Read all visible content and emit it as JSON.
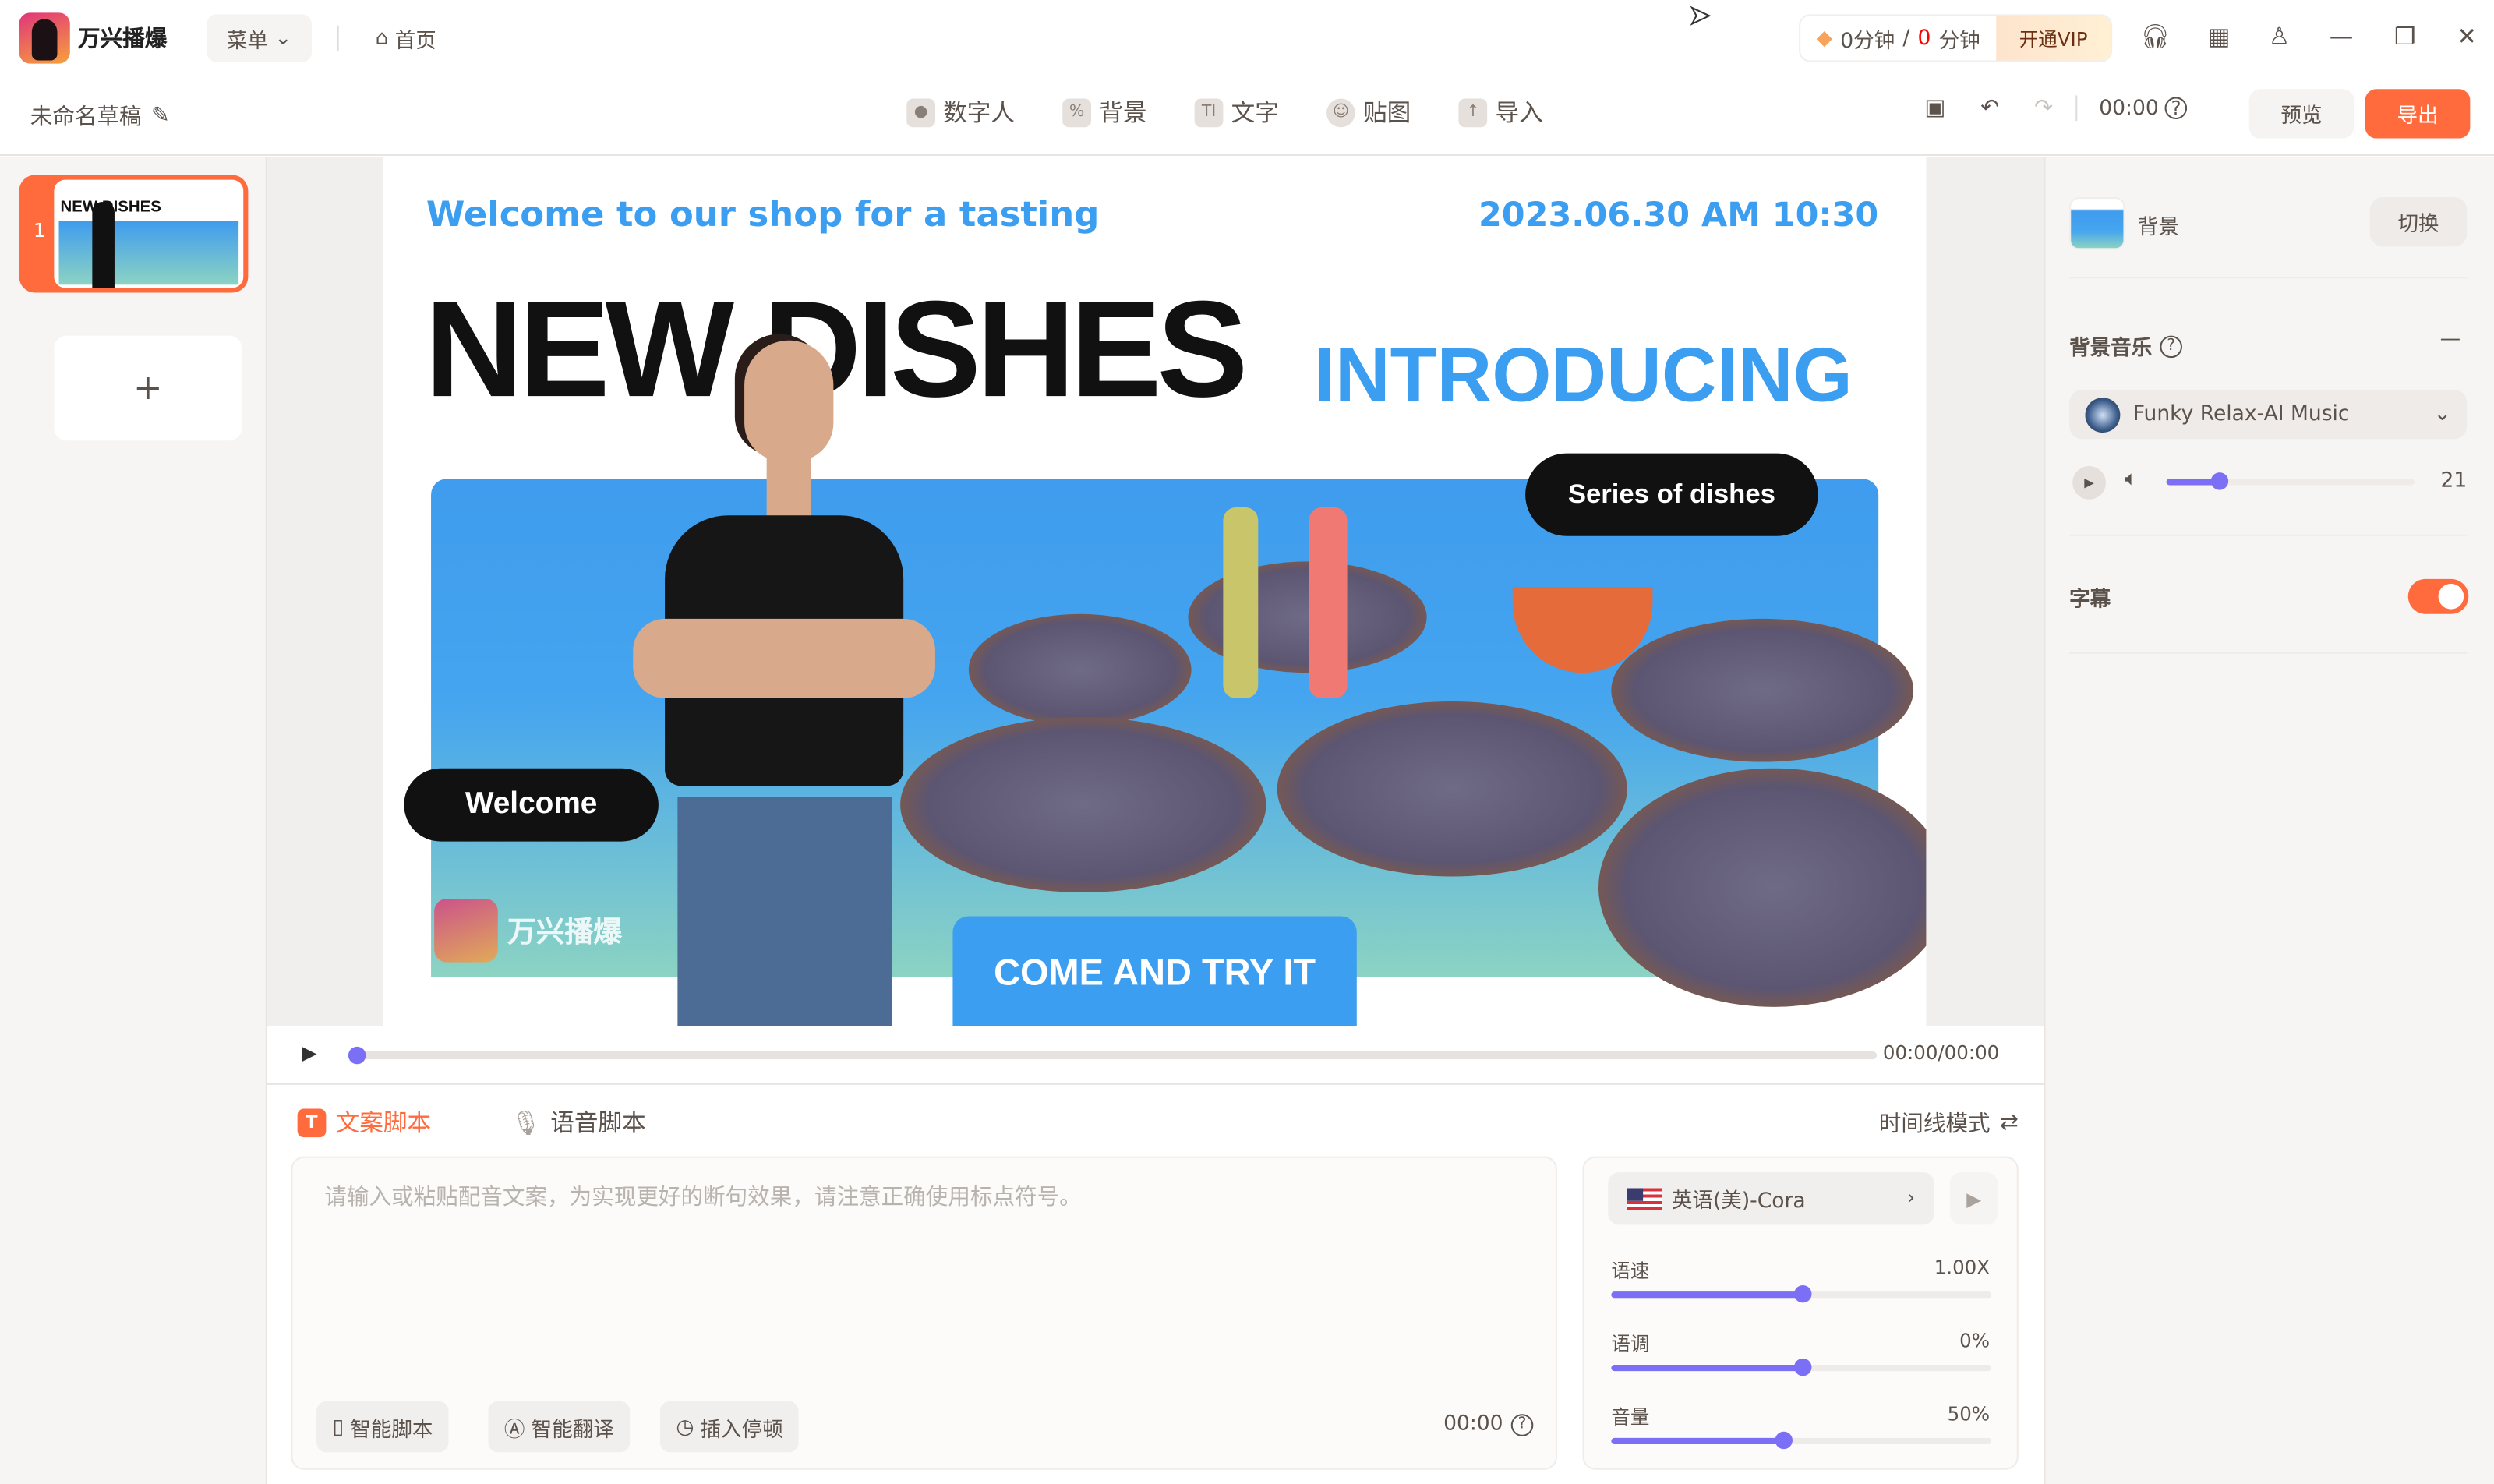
{
  "app": {
    "name": "万兴播爆",
    "menu_label": "菜单",
    "home_label": "首页",
    "draft_title": "未命名草稿"
  },
  "quota": {
    "used": "0分钟",
    "separator": "/",
    "remaining_num": "0",
    "remaining_unit": "分钟",
    "vip_label": "开通VIP",
    "remaining_color": "#ff0000"
  },
  "toolbar": {
    "items": [
      {
        "label": "数字人",
        "icon": "avatar-icon"
      },
      {
        "label": "背景",
        "icon": "background-icon"
      },
      {
        "label": "文字",
        "icon": "text-icon"
      },
      {
        "label": "贴图",
        "icon": "sticker-icon"
      },
      {
        "label": "导入",
        "icon": "import-icon"
      }
    ],
    "time": "00:00",
    "preview_label": "预览",
    "export_label": "导出"
  },
  "colors": {
    "accent": "#ff6b3d",
    "slider": "#7a6ff5",
    "slide_blue": "#3b9ef0"
  },
  "scenes": [
    {
      "number": "1"
    }
  ],
  "slide": {
    "welcome": "Welcome to our shop for a tasting",
    "date": "2023.06.30 AM 10:30",
    "title": "NEW DISHES",
    "subtitle": "INTRODUCING",
    "bubble_series": "Series of dishes",
    "bubble_welcome": "Welcome",
    "cta": "COME AND TRY IT",
    "watermark": "万兴播爆"
  },
  "player": {
    "time": "00:00/00:00",
    "progress": 0
  },
  "script": {
    "tabs": [
      {
        "label": "文案脚本",
        "active": true
      },
      {
        "label": "语音脚本",
        "active": false
      }
    ],
    "mode_label": "时间线模式",
    "placeholder": "请输入或粘贴配音文案，为实现更好的断句效果，请注意正确使用标点符号。",
    "actions": [
      "智能脚本",
      "智能翻译",
      "插入停顿"
    ],
    "duration": "00:00"
  },
  "voice": {
    "name": "英语(美)-Cora",
    "sliders": [
      {
        "label": "语速",
        "value": "1.00X",
        "fraction": 0.5
      },
      {
        "label": "语调",
        "value": "0%",
        "fraction": 0.5
      },
      {
        "label": "音量",
        "value": "50%",
        "fraction": 0.45
      }
    ]
  },
  "panel": {
    "background_label": "背景",
    "switch_label": "切换",
    "music_title": "背景音乐",
    "music_name": "Funky Relax-AI Music",
    "music_volume": "21",
    "music_volume_fraction": 0.21,
    "subtitle_label": "字幕",
    "subtitle_on": true
  }
}
